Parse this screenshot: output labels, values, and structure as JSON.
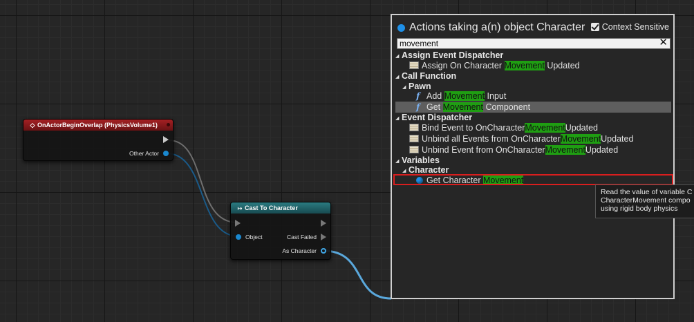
{
  "event_node": {
    "title": "OnActorBeginOverlap (PhysicsVolume1)",
    "pin_other_actor": "Other Actor"
  },
  "cast_node": {
    "title": "Cast To Character",
    "pin_object": "Object",
    "pin_cast_failed": "Cast Failed",
    "pin_as_character": "As Character"
  },
  "panel": {
    "title": "Actions taking a(n) object Character",
    "context_sensitive_label": "Context Sensitive",
    "context_sensitive_checked": true,
    "search_value": "movement",
    "highlight_color": "#1f9e12",
    "items": [
      {
        "kind": "category",
        "label": "Assign Event Dispatcher"
      },
      {
        "kind": "var",
        "pre": "Assign On Character ",
        "hl": "Movement",
        "post": " Updated"
      },
      {
        "kind": "category",
        "label": "Call Function"
      },
      {
        "kind": "subcategory",
        "label": "Pawn"
      },
      {
        "kind": "func",
        "pre": "Add ",
        "hl": "Movement",
        "post": " Input"
      },
      {
        "kind": "func",
        "pre": "Get ",
        "hl": "Movement",
        "post": " Component",
        "selected": true
      },
      {
        "kind": "category",
        "label": "Event Dispatcher"
      },
      {
        "kind": "var",
        "pre": "Bind Event to OnCharacter",
        "hl": "Movement",
        "post": "Updated"
      },
      {
        "kind": "var",
        "pre": "Unbind all Events from OnCharacter",
        "hl": "Movement",
        "post": "Updated"
      },
      {
        "kind": "var",
        "pre": "Unbind Event from OnCharacter",
        "hl": "Movement",
        "post": "Updated"
      },
      {
        "kind": "category",
        "label": "Variables"
      },
      {
        "kind": "subcategory",
        "label": "Character"
      },
      {
        "kind": "getvar",
        "pre": "Get Character ",
        "hl": "Movement",
        "post": ""
      }
    ]
  },
  "tooltip": {
    "lines": [
      "Read the value of variable C",
      "CharacterMovement compo",
      "using rigid body physics"
    ]
  }
}
